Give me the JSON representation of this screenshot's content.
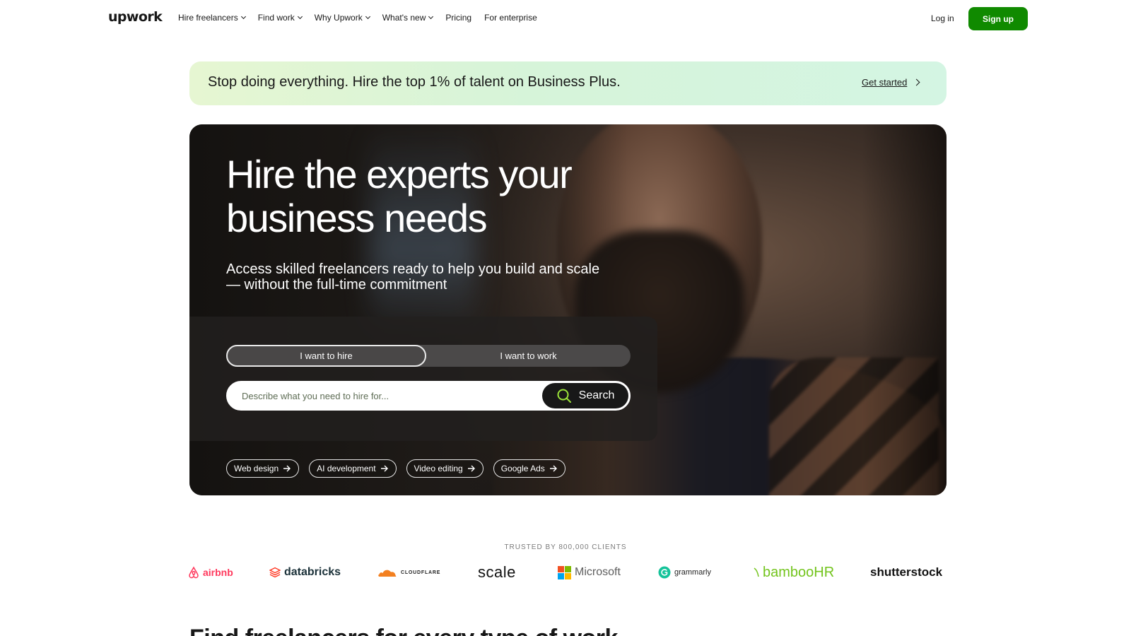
{
  "nav": {
    "logo": "upwork",
    "links": [
      "Hire freelancers",
      "Find work",
      "Why Upwork",
      "What's new",
      "Pricing",
      "For enterprise"
    ],
    "login": "Log in",
    "signup": "Sign up",
    "accent": "#108a00"
  },
  "promo": {
    "text": "Stop doing everything. Hire the top 1% of talent on Business Plus.",
    "cta": "Get started"
  },
  "hero": {
    "title_line1": "Hire the experts your",
    "title_line2": "business needs",
    "subtitle_line1": "Access skilled freelancers ready to help you build and scale",
    "subtitle_line2": "— without the full-time commitment",
    "toggle_hire": "I want to hire",
    "toggle_work": "I want to work",
    "search_placeholder": "Describe what you need to hire for...",
    "search_button": "Search",
    "chips": [
      "Web design",
      "AI development",
      "Video editing",
      "Google Ads"
    ]
  },
  "trusted": {
    "label": "TRUSTED BY 800,000 CLIENTS",
    "brands": [
      "airbnb",
      "databricks",
      "CLOUDFLARE",
      "scale",
      "Microsoft",
      "grammarly",
      "bambooHR",
      "shutterstock"
    ]
  },
  "section": {
    "title": "Find freelancers for every type of work"
  }
}
